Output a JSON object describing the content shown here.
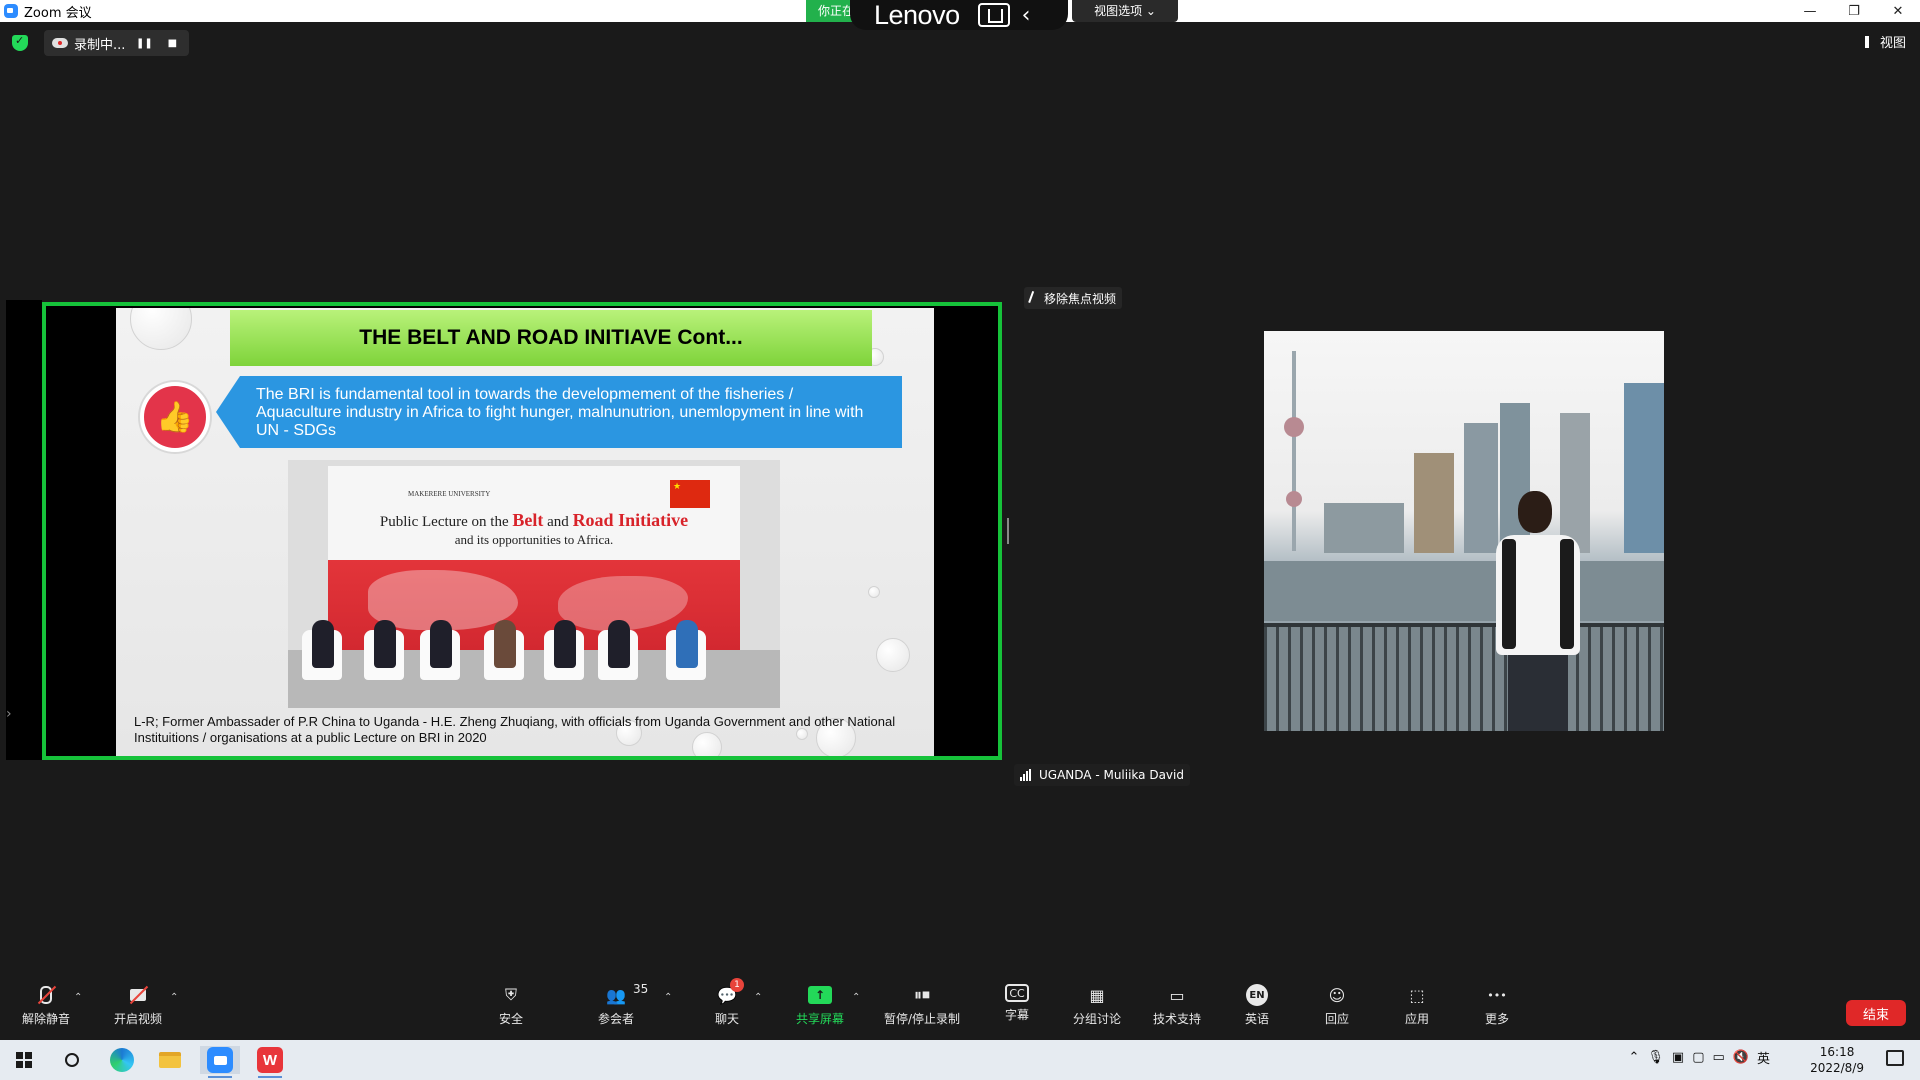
{
  "window": {
    "title": "Zoom 会议",
    "controls": {
      "minimize": "—",
      "maximize": "❐",
      "close": "✕"
    }
  },
  "top_overlay": {
    "share_banner": "你正在",
    "brand": "Lenovo",
    "chevron": "‹",
    "view_options": "视图选项 ⌄"
  },
  "recording": {
    "label": "录制中...",
    "pause": "❚❚",
    "stop": "■"
  },
  "view_button": "视图",
  "unpin_label": "移除焦点视频",
  "slide": {
    "title": "THE BELT AND ROAD INITIAVE Cont...",
    "bullet": "The BRI is fundamental tool in towards the developmement of the fisheries / Aquaculture industry in Africa to fight hunger, malnunutrion, unemlopyment in line with UN - SDGs",
    "photo": {
      "university": "MAKERERE       UNIVERSITY",
      "lecture_prefix": "Public Lecture on the ",
      "lecture_belt": "Belt",
      "lecture_and": " and ",
      "lecture_road": "Road Initiative",
      "lecture_sub": "and its opportunities to Africa."
    },
    "caption": "L-R; Former Ambassader of P.R China to  Uganda - H.E. Zheng Zhuqiang, with officials from Uganda Government and other National Instituitions / organisations at a public Lecture on BRI in 2020"
  },
  "participant": {
    "name": "UGANDA - Muliika David"
  },
  "toolbar": {
    "unmute": "解除静音",
    "start_video": "开启视频",
    "security": "安全",
    "participants": "参会者",
    "participants_count": "35",
    "chat": "聊天",
    "chat_badge": "1",
    "share_screen": "共享屏幕",
    "record": "暂停/停止录制",
    "captions": "字幕",
    "captions_icon": "CC",
    "breakout": "分组讨论",
    "support": "技术支持",
    "language": "英语",
    "language_icon": "EN",
    "reactions": "回应",
    "apps": "应用",
    "more": "更多",
    "more_icon": "•••",
    "end": "结束"
  },
  "taskbar": {
    "time": "16:18",
    "date": "2022/8/9",
    "ime": "英",
    "wps_letter": "W"
  },
  "colors": {
    "share_border": "#16c23a",
    "accent_green": "#23d959",
    "end_red": "#e02828",
    "callout_blue": "#2b96e1",
    "thumb_red": "#e3344a"
  }
}
